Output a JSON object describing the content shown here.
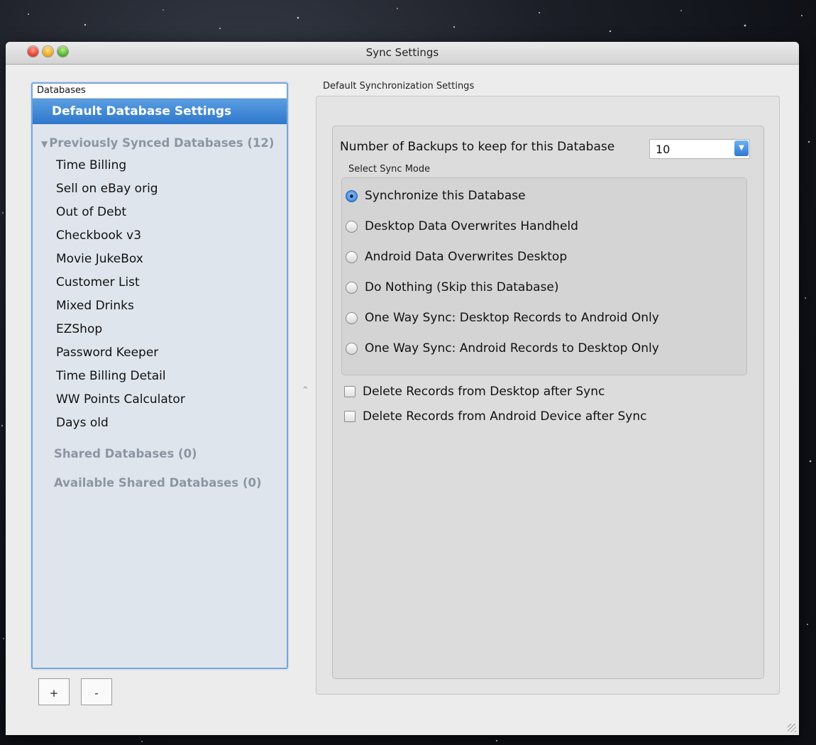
{
  "window": {
    "title": "Sync Settings"
  },
  "sidebar": {
    "header": "Databases",
    "selected": "Default Database Settings",
    "previous_group": "Previously Synced Databases (12)",
    "items": [
      "Time Billing",
      "Sell on eBay orig",
      "Out of Debt",
      "Checkbook v3",
      "Movie JukeBox",
      "Customer List",
      "Mixed Drinks",
      "EZShop",
      "Password Keeper",
      "Time Billing Detail",
      "WW Points Calculator",
      "Days old"
    ],
    "shared_group": "Shared Databases (0)",
    "available_group": "Available Shared Databases (0)",
    "add_label": "+",
    "remove_label": "-"
  },
  "settings": {
    "title": "Default Synchronization Settings",
    "backups_label": "Number of Backups to keep for this Database",
    "backups_value": "10",
    "mode_title": "Select Sync Mode",
    "modes": [
      {
        "label": "Synchronize this Database",
        "selected": true
      },
      {
        "label": "Desktop Data Overwrites Handheld",
        "selected": false
      },
      {
        "label": "Android Data Overwrites Desktop",
        "selected": false
      },
      {
        "label": "Do Nothing (Skip this Database)",
        "selected": false
      },
      {
        "label": "One Way Sync: Desktop Records to Android Only",
        "selected": false
      },
      {
        "label": "One Way Sync: Android Records to Desktop Only",
        "selected": false
      }
    ],
    "checks": [
      {
        "label": "Delete Records from Desktop after Sync",
        "checked": false
      },
      {
        "label": "Delete Records from Android Device after Sync",
        "checked": false
      }
    ]
  },
  "icons": {
    "dropdown": "chevron-down-icon",
    "disclosure": "disclosure-triangle-icon"
  }
}
